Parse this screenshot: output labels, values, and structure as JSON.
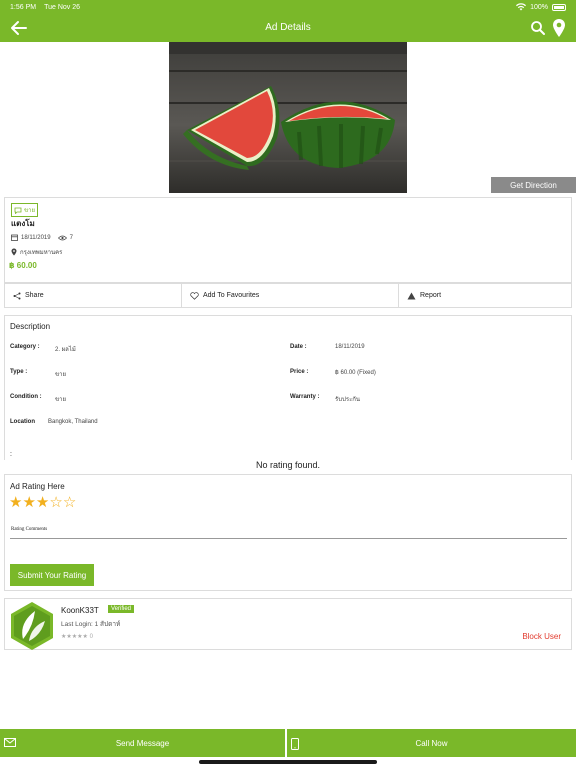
{
  "status_bar": {
    "time": "1:56 PM",
    "date": "Tue Nov 26",
    "battery": "100%"
  },
  "nav": {
    "title": "Ad Details",
    "back_icon": "arrow-left-icon",
    "search_icon": "search-icon",
    "location_icon": "map-pin-icon"
  },
  "hero": {
    "get_direction_label": "Get Direction"
  },
  "ad": {
    "tag": "ขาย",
    "title": "แตงโม",
    "date": "18/11/2019",
    "views": "7",
    "location": "กรุงเทพมหานคร",
    "price": "฿ 60.00"
  },
  "actions": {
    "share": "Share",
    "favourite": "Add To Favourites",
    "report": "Report"
  },
  "description": {
    "title": "Description",
    "category_label": "Category :",
    "category_value": "2. ผลไม้",
    "date_label": "Date :",
    "date_value": "18/11/2019",
    "type_label": "Type :",
    "type_value": "ขาย",
    "price_label": "Price :",
    "price_value": "฿ 60.00 (Fixed)",
    "condition_label": "Condition :",
    "condition_value": "ขาย",
    "warranty_label": "Warranty :",
    "warranty_value": "รับประกัน",
    "location_label": "Location",
    "location_value": "Bangkok, Thailand",
    "trailing_colon": ":"
  },
  "rating": {
    "no_rating_text": "No rating found.",
    "title": "Ad Rating Here",
    "stars_value": 3,
    "stars_max": 5,
    "comments_label": "Rating Comments",
    "submit_label": "Submit Your Rating"
  },
  "seller": {
    "name": "KoonK33T",
    "verified": "Verified",
    "last_login": "Last Login: 1 สัปดาห์",
    "stars": "★★★★★",
    "rating_count": "0",
    "block_label": "Block User"
  },
  "bottom": {
    "send_message": "Send Message",
    "call_now": "Call Now"
  },
  "colors": {
    "accent": "#7ab829",
    "danger": "#e23b2e",
    "star": "#f2b01e"
  }
}
